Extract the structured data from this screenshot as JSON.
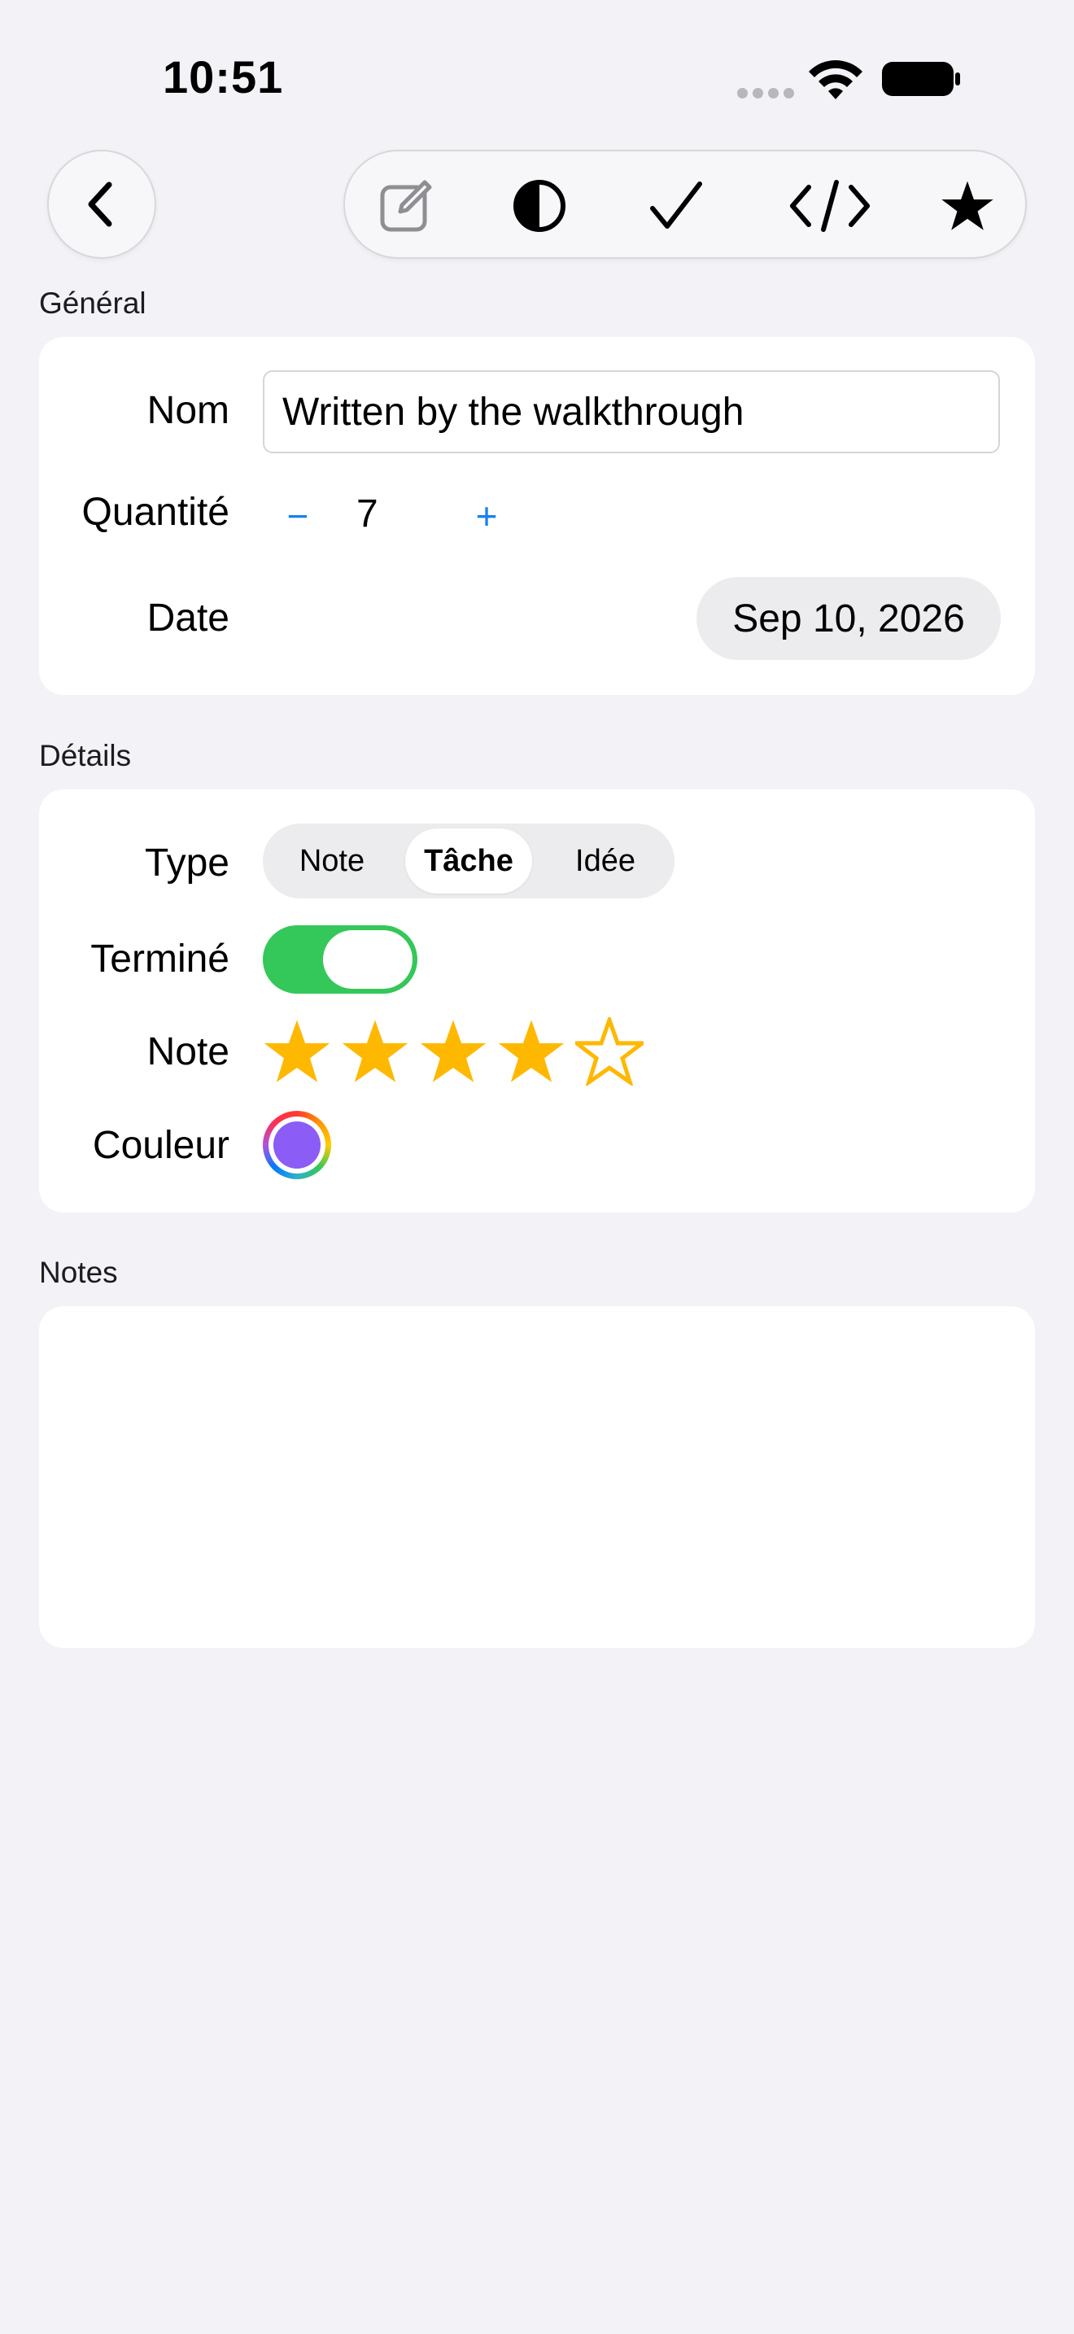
{
  "status_bar": {
    "time": "10:51"
  },
  "nav": {
    "back_icon": "chevron-left-icon",
    "toolbar_icons": [
      "compose-icon",
      "contrast-icon",
      "checkmark-icon",
      "code-icon",
      "star-icon"
    ]
  },
  "general": {
    "header": "Général",
    "name_label": "Nom",
    "name_value": "Written by the walkthrough",
    "quantity_label": "Quantité",
    "quantity_value": "7",
    "minus_label": "−",
    "plus_label": "+",
    "date_label": "Date",
    "date_value": "Sep 10, 2026"
  },
  "details": {
    "header": "Détails",
    "type_label": "Type",
    "type_options": [
      "Note",
      "Tâche",
      "Idée"
    ],
    "type_selected": "Tâche",
    "done_label": "Terminé",
    "done_on": true,
    "rating_label": "Note",
    "rating_value": 4,
    "rating_max": 5,
    "color_label": "Couleur",
    "color_value": "#8b5cf6"
  },
  "notes": {
    "header": "Notes",
    "value": ""
  },
  "colors": {
    "background": "#f2f2f7",
    "accent": "#1a80f0",
    "toggle_on": "#34c759",
    "star": "#ffb800"
  }
}
